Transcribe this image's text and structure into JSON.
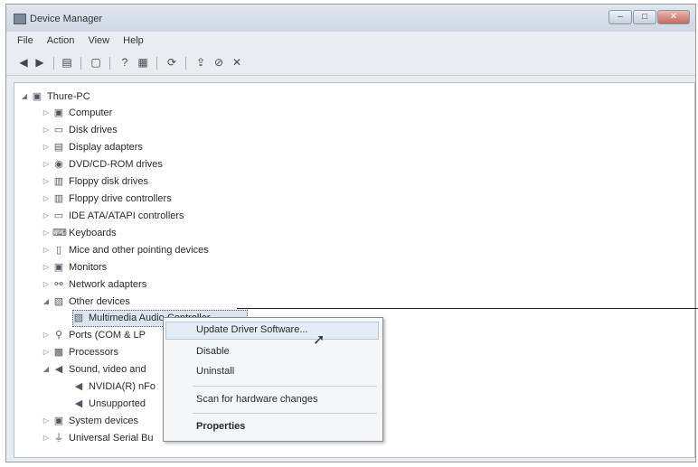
{
  "window": {
    "title": "Device Manager",
    "controls": {
      "minimize": "–",
      "maximize": "□",
      "close": "✕"
    }
  },
  "menu": [
    "File",
    "Action",
    "View",
    "Help"
  ],
  "toolbar": [
    {
      "name": "back-icon",
      "glyph": "◀"
    },
    {
      "name": "forward-icon",
      "glyph": "▶"
    },
    {
      "name": "show-hide-icon",
      "glyph": "▤"
    },
    {
      "name": "console-tree-icon",
      "glyph": "▢"
    },
    {
      "name": "help-icon",
      "glyph": "?"
    },
    {
      "name": "properties-icon",
      "glyph": "▦"
    },
    {
      "name": "scan-icon",
      "glyph": "⟳"
    },
    {
      "name": "update-driver-icon",
      "glyph": "⇪"
    },
    {
      "name": "disable-icon",
      "glyph": "⊘"
    },
    {
      "name": "uninstall-icon",
      "glyph": "✕"
    }
  ],
  "tree": {
    "root": "Thure-PC",
    "items": [
      {
        "label": "Computer",
        "expanded": false
      },
      {
        "label": "Disk drives",
        "expanded": false
      },
      {
        "label": "Display adapters",
        "expanded": false
      },
      {
        "label": "DVD/CD-ROM drives",
        "expanded": false
      },
      {
        "label": "Floppy disk drives",
        "expanded": false
      },
      {
        "label": "Floppy drive controllers",
        "expanded": false
      },
      {
        "label": "IDE ATA/ATAPI controllers",
        "expanded": false
      },
      {
        "label": "Keyboards",
        "expanded": false
      },
      {
        "label": "Mice and other pointing devices",
        "expanded": false
      },
      {
        "label": "Monitors",
        "expanded": false
      },
      {
        "label": "Network adapters",
        "expanded": false
      },
      {
        "label": "Other devices",
        "expanded": true
      },
      {
        "label": "Multimedia Audio Controller",
        "child": true,
        "selected": true
      },
      {
        "label": "Ports (COM & LPT)",
        "visible_label": "Ports (COM & LP",
        "expanded": false
      },
      {
        "label": "Processors",
        "expanded": false
      },
      {
        "label": "Sound, video and",
        "expanded": true
      },
      {
        "label": "NVIDIA(R) nFo",
        "child": true
      },
      {
        "label": "Unsupported",
        "child": true
      },
      {
        "label": "System devices",
        "expanded": false
      },
      {
        "label": "Universal Serial Bu",
        "expanded": false
      }
    ]
  },
  "context_menu": {
    "items": [
      {
        "label": "Update Driver Software...",
        "hovered": true
      },
      {
        "label": "Disable"
      },
      {
        "label": "Uninstall"
      },
      {
        "label": "Scan for hardware changes"
      },
      {
        "label": "Properties",
        "bold": true
      }
    ]
  }
}
